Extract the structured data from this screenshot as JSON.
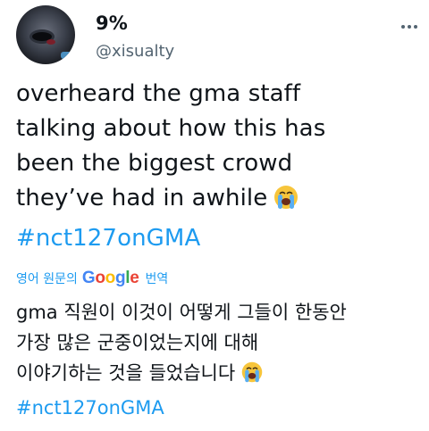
{
  "author": {
    "display_name": "9%",
    "handle": "@xisualty"
  },
  "tweet": {
    "lines": [
      "overheard the gma staff",
      "talking about how this has",
      "been the biggest crowd",
      "they’ve had in awhile"
    ],
    "hashtag": "#nct127onGMA",
    "emoji": "loudly-crying-face-icon"
  },
  "translation": {
    "label": "영어 원문의",
    "provider": "Google",
    "provider_letters": [
      "G",
      "o",
      "o",
      "g",
      "l",
      "e"
    ],
    "provider_colors": [
      "#4285f4",
      "#ea4335",
      "#fbbc05",
      "#4285f4",
      "#34a853",
      "#ea4335"
    ],
    "suffix": "번역",
    "lines": [
      "gma 직원이 이것이 어떻게 그들이 한동안",
      "가장 많은 군중이었는지에 대해",
      "이야기하는 것을 들었습니다"
    ],
    "hashtag": "#nct127onGMA"
  },
  "colors": {
    "text": "#0f1419",
    "secondary": "#536471",
    "link": "#1d9bf0"
  }
}
